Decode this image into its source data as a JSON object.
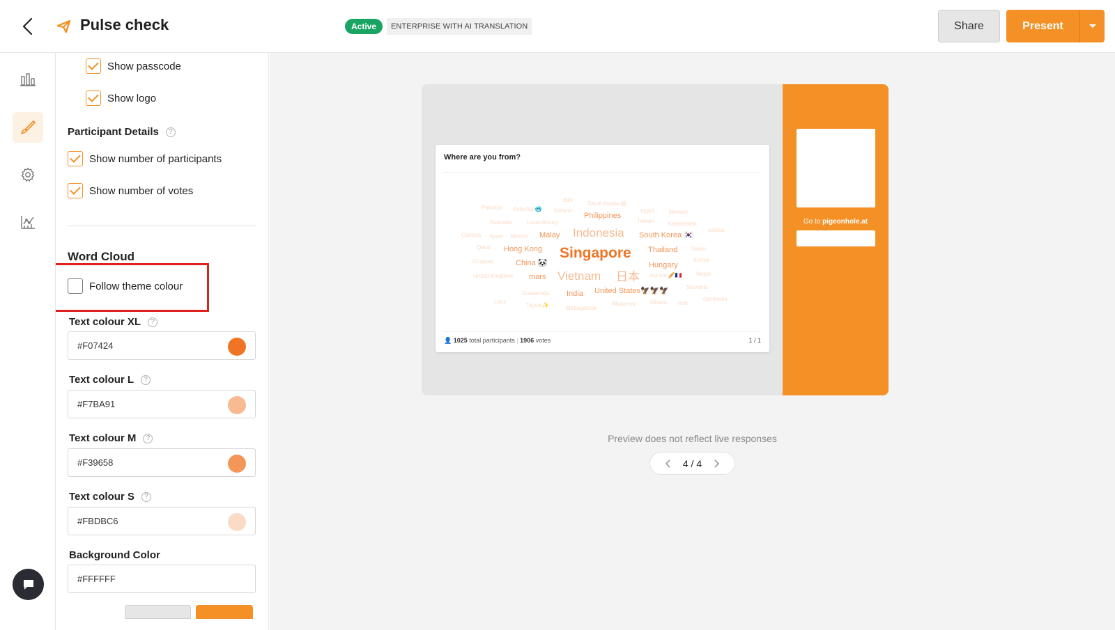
{
  "header": {
    "title": "Pulse check",
    "status_badge": "Active",
    "plan_badge": "ENTERPRISE WITH AI TRANSLATION",
    "share_label": "Share",
    "present_label": "Present",
    "accent_color": "#F39126"
  },
  "rail": {
    "items": [
      {
        "name": "results-icon",
        "active": false
      },
      {
        "name": "design-brush-icon",
        "active": true
      },
      {
        "name": "settings-gear-icon",
        "active": false
      },
      {
        "name": "analytics-icon",
        "active": false
      }
    ]
  },
  "panel": {
    "show_passcode": {
      "label": "Show passcode",
      "checked": true
    },
    "show_logo": {
      "label": "Show logo",
      "checked": true
    },
    "participant_details": {
      "label": "Participant Details",
      "help": "?"
    },
    "show_participants": {
      "label": "Show number of participants",
      "checked": true
    },
    "show_votes": {
      "label": "Show number of votes",
      "checked": true
    },
    "word_cloud_title": "Word Cloud",
    "follow_theme": {
      "label": "Follow theme colour",
      "checked": false
    },
    "colors": [
      {
        "label": "Text colour XL",
        "value": "#F07424",
        "swatch": "#F07424"
      },
      {
        "label": "Text colour L",
        "value": "#F7BA91",
        "swatch": "#F7BA91"
      },
      {
        "label": "Text colour M",
        "value": "#F39658",
        "swatch": "#F39658"
      },
      {
        "label": "Text colour S",
        "value": "#FBDBC6",
        "swatch": "#FBDBC6"
      }
    ],
    "background": {
      "label": "Background Color",
      "value": "#FFFFFF"
    }
  },
  "preview": {
    "question": "Where are you from?",
    "goto_prefix": "Go to",
    "goto_site": "pigeonhole.at",
    "participants_count": "1025",
    "participants_label": "total participants",
    "votes_count": "1906",
    "votes_label": "votes",
    "card_page": "1 / 1",
    "note": "Preview does not reflect live responses",
    "pager": "4 / 4",
    "words": [
      {
        "text": "Singapore",
        "size": "xl"
      },
      {
        "text": "Indonesia",
        "size": "l"
      },
      {
        "text": "Vietnam",
        "size": "l"
      },
      {
        "text": "日本",
        "size": "l"
      },
      {
        "text": "Philippines",
        "size": "m"
      },
      {
        "text": "Malay",
        "size": "m"
      },
      {
        "text": "South Korea 🇰🇷",
        "size": "m"
      },
      {
        "text": "Hong Kong",
        "size": "m"
      },
      {
        "text": "Thailand",
        "size": "m"
      },
      {
        "text": "China 🐼",
        "size": "m"
      },
      {
        "text": "Hungary",
        "size": "m"
      },
      {
        "text": "mars",
        "size": "m"
      },
      {
        "text": "India",
        "size": "m"
      },
      {
        "text": "United States🦅🦅🦅",
        "size": "m"
      },
      {
        "text": "Pakistan",
        "size": "s"
      },
      {
        "text": "Antartica🥶",
        "size": "s"
      },
      {
        "text": "Iceland",
        "size": "s"
      },
      {
        "text": "Italy",
        "size": "s"
      },
      {
        "text": "Saudi Arabia 😱",
        "size": "s"
      },
      {
        "text": "egypt",
        "size": "s"
      },
      {
        "text": "Norway",
        "size": "s"
      },
      {
        "text": "Australia",
        "size": "s"
      },
      {
        "text": "Luxembourg",
        "size": "s"
      },
      {
        "text": "Taiwan",
        "size": "s"
      },
      {
        "text": "Kazakhstan",
        "size": "s"
      },
      {
        "text": "Canada",
        "size": "s"
      },
      {
        "text": "Spain",
        "size": "s"
      },
      {
        "text": "Mexico",
        "size": "s"
      },
      {
        "text": "russia!",
        "size": "s"
      },
      {
        "text": "Qatar",
        "size": "s"
      },
      {
        "text": "Swiss",
        "size": "s"
      },
      {
        "text": "Uruguay",
        "size": "s"
      },
      {
        "text": "Kenya",
        "size": "s"
      },
      {
        "text": "United Kingdom",
        "size": "s"
      },
      {
        "text": "oui oui 🥖🇫🇷",
        "size": "s"
      },
      {
        "text": "Nepal",
        "size": "s"
      },
      {
        "text": "Guatemala",
        "size": "s"
      },
      {
        "text": "Slovenia",
        "size": "s"
      },
      {
        "text": "Laos",
        "size": "s"
      },
      {
        "text": "Teyvat✨",
        "size": "s"
      },
      {
        "text": "Madagascar",
        "size": "s"
      },
      {
        "text": "Myanmar",
        "size": "s"
      },
      {
        "text": "Ghana",
        "size": "s"
      },
      {
        "text": "Iran",
        "size": "s"
      },
      {
        "text": "cambodia",
        "size": "s"
      }
    ]
  }
}
